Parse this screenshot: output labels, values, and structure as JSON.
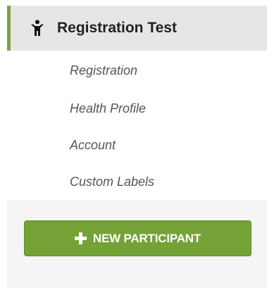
{
  "header": {
    "icon": "person-icon",
    "title": "Registration Test"
  },
  "submenu": {
    "items": [
      {
        "label": "Registration"
      },
      {
        "label": "Health Profile"
      },
      {
        "label": "Account"
      },
      {
        "label": "Custom Labels"
      }
    ]
  },
  "actions": {
    "new_participant_label": "NEW PARTICIPANT"
  },
  "colors": {
    "accent": "#7da43b",
    "button": "#75a237",
    "header_bg": "#e6e6e6",
    "footer_bg": "#f5f5f5"
  }
}
